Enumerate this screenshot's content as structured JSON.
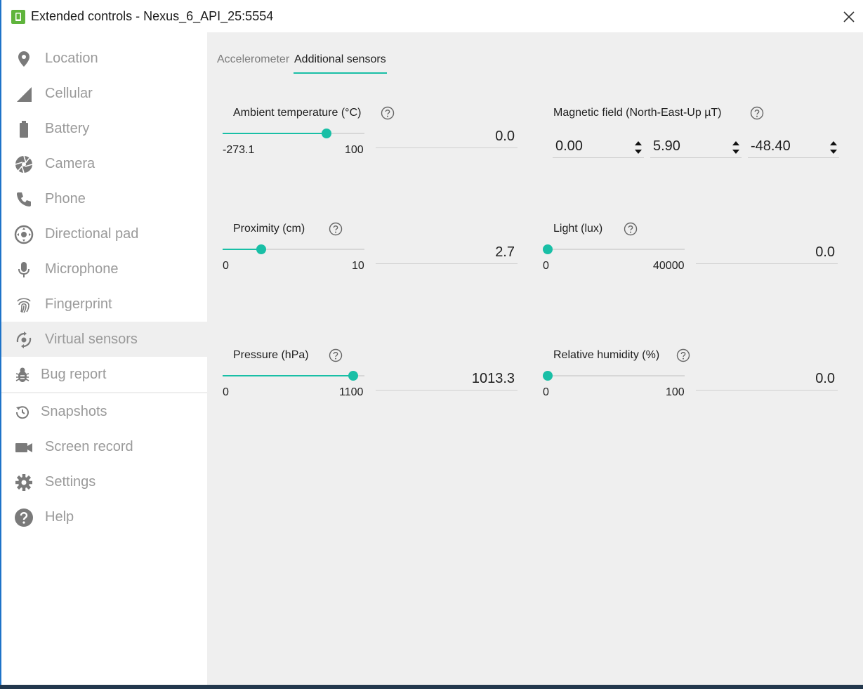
{
  "window": {
    "title": "Extended controls - Nexus_6_API_25:5554",
    "accent_color": "#19bfa6"
  },
  "sidebar": {
    "items": [
      {
        "label": "Location",
        "icon": "location-pin-icon"
      },
      {
        "label": "Cellular",
        "icon": "cellular-signal-icon"
      },
      {
        "label": "Battery",
        "icon": "battery-icon"
      },
      {
        "label": "Camera",
        "icon": "camera-aperture-icon"
      },
      {
        "label": "Phone",
        "icon": "phone-icon"
      },
      {
        "label": "Directional pad",
        "icon": "dpad-icon"
      },
      {
        "label": "Microphone",
        "icon": "microphone-icon"
      },
      {
        "label": "Fingerprint",
        "icon": "fingerprint-icon"
      },
      {
        "label": "Virtual sensors",
        "icon": "rotate-sensor-icon",
        "selected": true
      },
      {
        "label": "Bug report",
        "icon": "bug-icon"
      },
      {
        "label": "Snapshots",
        "icon": "history-icon"
      },
      {
        "label": "Screen record",
        "icon": "video-camera-icon"
      },
      {
        "label": "Settings",
        "icon": "gear-icon"
      },
      {
        "label": "Help",
        "icon": "help-circle-icon"
      }
    ]
  },
  "tabs": [
    {
      "label": "Accelerometer",
      "active": false
    },
    {
      "label": "Additional sensors",
      "active": true
    }
  ],
  "sensors": {
    "ambient_temperature": {
      "label": "Ambient temperature (°C)",
      "min": "-273.1",
      "max": "100",
      "value": "0.0",
      "level": 0.732
    },
    "magnetic_field": {
      "label": "Magnetic field (North-East-Up µT)",
      "x": "0.00",
      "y": "5.90",
      "z": "-48.40"
    },
    "proximity": {
      "label": "Proximity (cm)",
      "min": "0",
      "max": "10",
      "value": "2.7",
      "level": 0.27
    },
    "light": {
      "label": "Light (lux)",
      "min": "0",
      "max": "40000",
      "value": "0.0",
      "level": 0.0
    },
    "pressure": {
      "label": "Pressure (hPa)",
      "min": "0",
      "max": "1100",
      "value": "1013.3",
      "level": 0.921
    },
    "relative_humidity": {
      "label": "Relative humidity (%)",
      "min": "0",
      "max": "100",
      "value": "0.0",
      "level": 0.0
    }
  }
}
